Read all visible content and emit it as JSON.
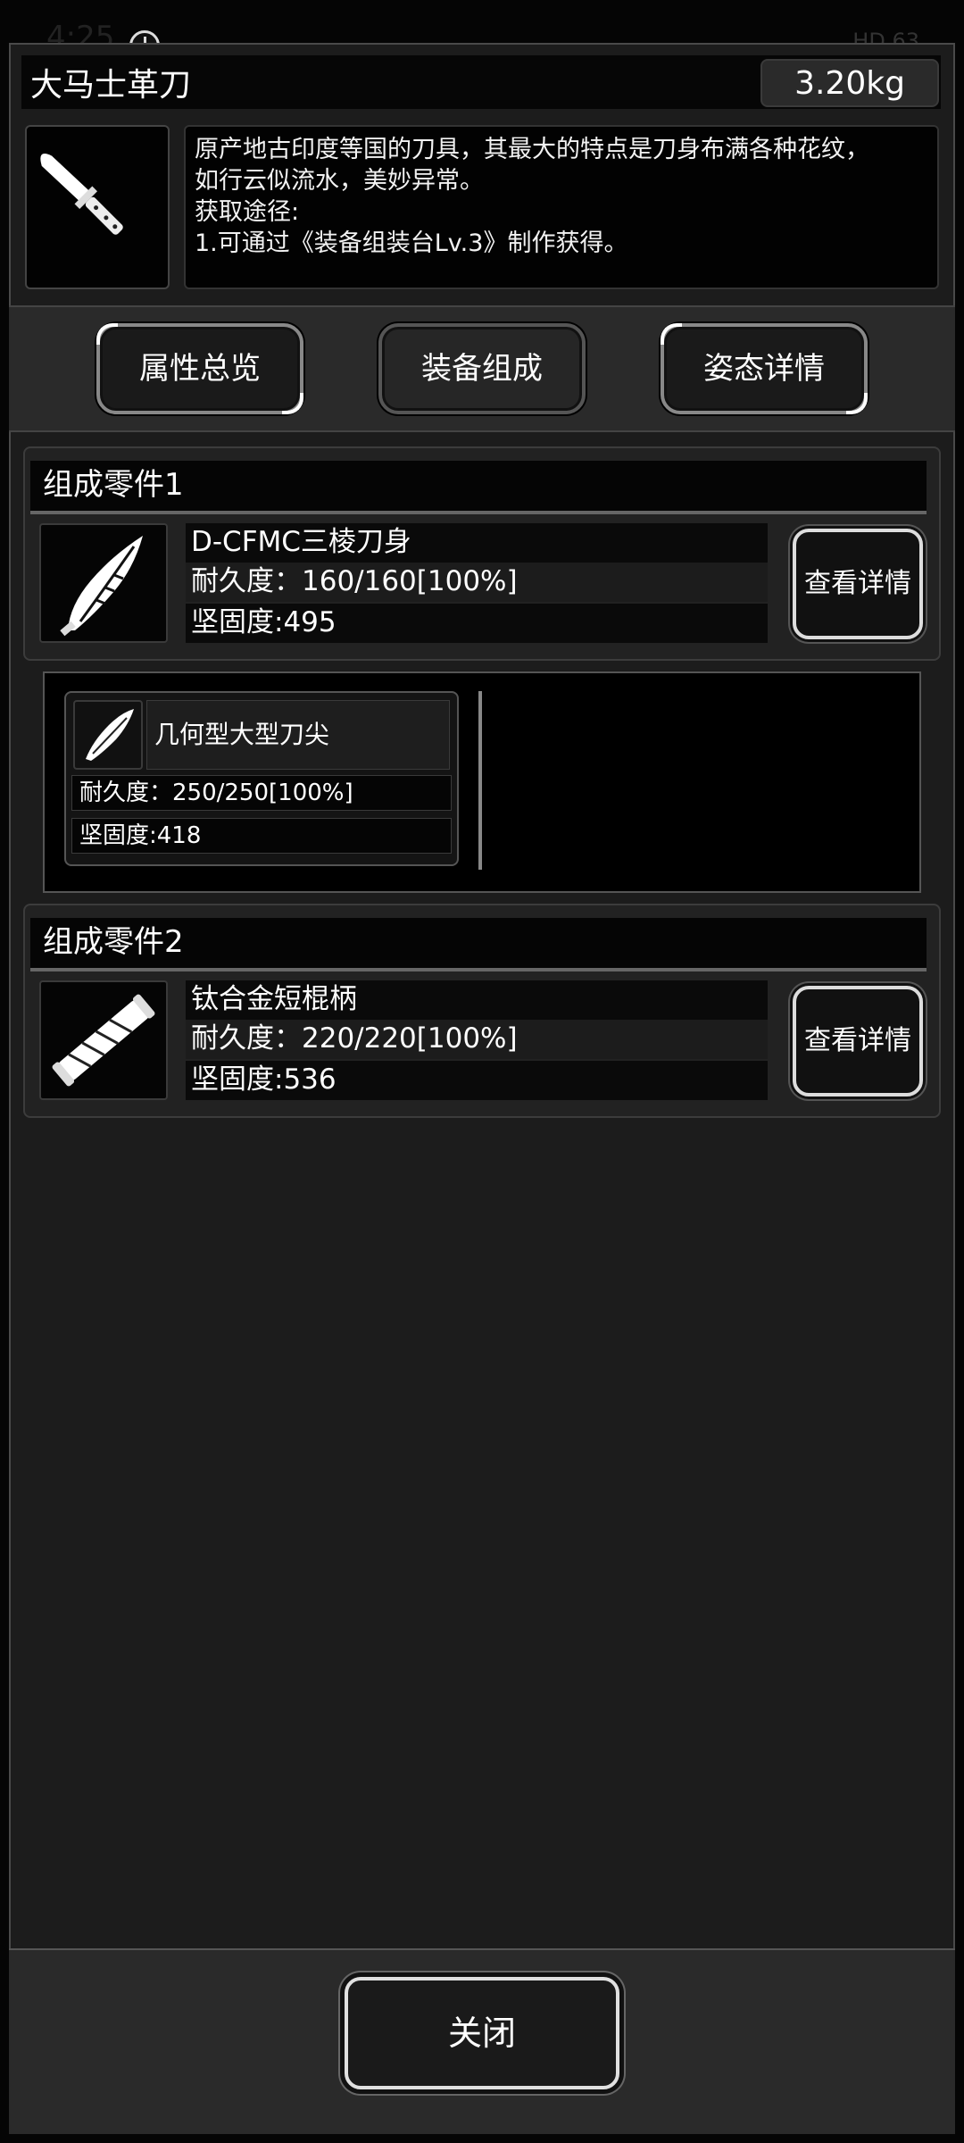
{
  "status_bar": {
    "time": "4:25",
    "right": "HD 63"
  },
  "item": {
    "name": "大马士革刀",
    "weight": "3.20kg",
    "description_lines": [
      "原产地古印度等国的刀具，其最大的特点是刀身布满各种花纹，",
      "如行云似流水，美妙异常。",
      "获取途径:",
      "1.可通过《装备组装台Lv.3》制作获得。"
    ]
  },
  "tabs": [
    {
      "label": "属性总览",
      "active": false
    },
    {
      "label": "装备组成",
      "active": true
    },
    {
      "label": "姿态详情",
      "active": false
    }
  ],
  "parts": [
    {
      "section_title": "组成零件1",
      "name": "D-CFMC三棱刀身",
      "durability": "耐久度：160/160[100%]",
      "hardness": "坚固度:495",
      "detail_label": "查看详情",
      "sub_parts": [
        {
          "name": "几何型大型刀尖",
          "durability": "耐久度：250/250[100%]",
          "hardness": "坚固度:418"
        }
      ]
    },
    {
      "section_title": "组成零件2",
      "name": "钛合金短棍柄",
      "durability": "耐久度：220/220[100%]",
      "hardness": "坚固度:536",
      "detail_label": "查看详情"
    }
  ],
  "close_label": "关闭"
}
